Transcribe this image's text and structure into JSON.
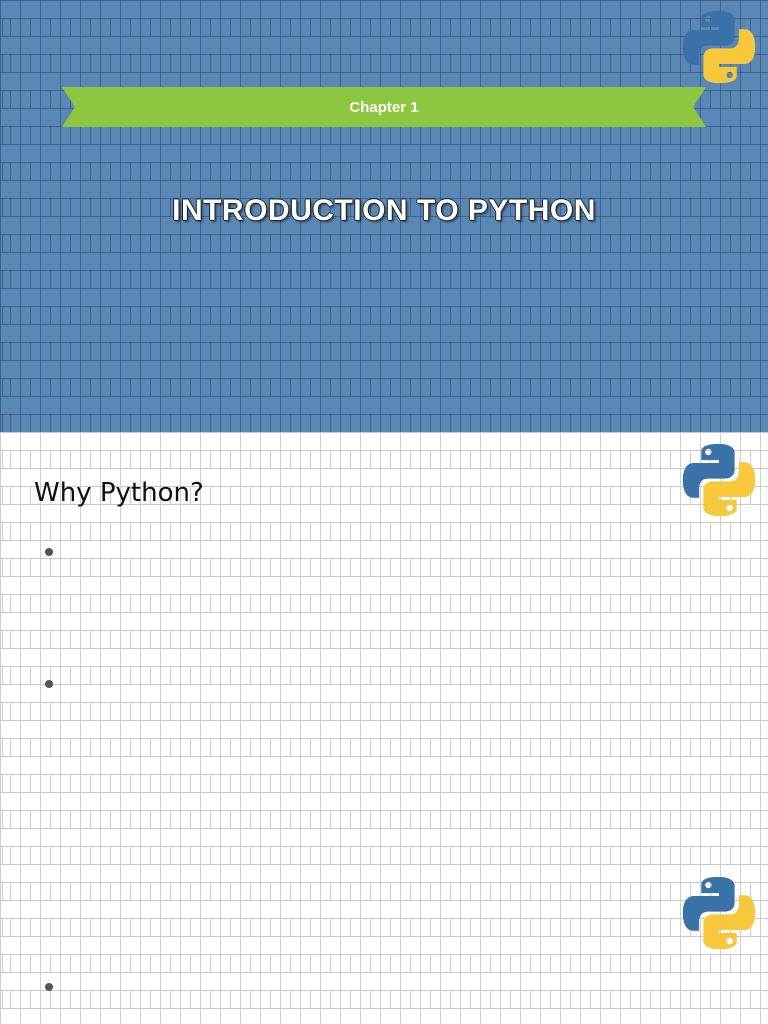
{
  "banner": {
    "label": "Chapter 1"
  },
  "title": "INTRODUCTION TO PYTHON",
  "section": {
    "heading": "Why Python?"
  },
  "logos": {
    "icon": "python-logo-icon",
    "colors": {
      "blue": "#3a72a8",
      "yellow": "#f7c83c"
    }
  },
  "colors": {
    "top_panel": "#5a88b6",
    "ribbon": "#8dc63f",
    "bottom_panel": "#ffffff"
  }
}
